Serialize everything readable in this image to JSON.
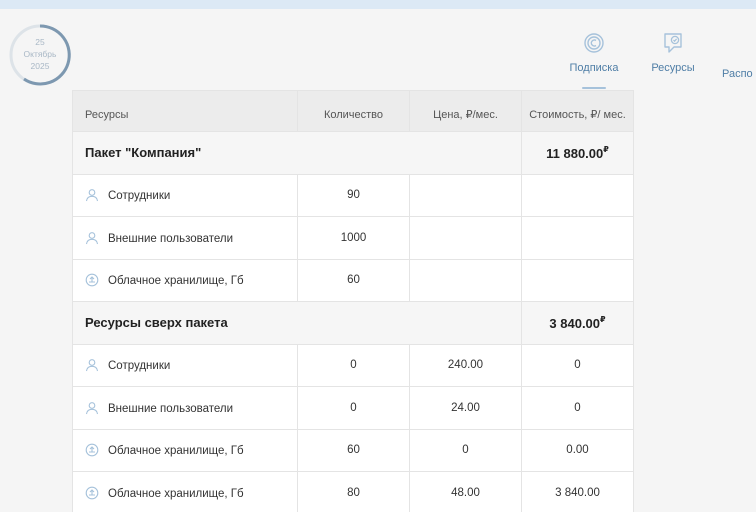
{
  "date": {
    "day": "25",
    "month": "Октябрь",
    "year": "2025"
  },
  "nav": [
    {
      "label": "Подписка",
      "icon": "subscription-icon",
      "active": true
    },
    {
      "label": "Ресурсы",
      "icon": "resources-icon",
      "active": false
    },
    {
      "label": "Распо",
      "icon": "schedule-icon",
      "active": false
    }
  ],
  "table": {
    "headers": [
      "Ресурсы",
      "Количество",
      "Цена, ₽/мес.",
      "Стоимость, ₽/ мес."
    ],
    "currency": "₽",
    "groups": [
      {
        "name": "Пакет \"Компания\"",
        "cost": "11 880.00",
        "rows": [
          {
            "icon": "user-icon",
            "name": "Сотрудники",
            "qty": "90",
            "price": "",
            "cost": ""
          },
          {
            "icon": "user-icon",
            "name": "Внешние пользователи",
            "qty": "1000",
            "price": "",
            "cost": ""
          },
          {
            "icon": "cloud-upload-icon",
            "name": "Облачное хранилище, Гб",
            "qty": "60",
            "price": "",
            "cost": ""
          }
        ]
      },
      {
        "name": "Ресурсы сверх пакета",
        "cost": "3 840.00",
        "rows": [
          {
            "icon": "user-icon",
            "name": "Сотрудники",
            "qty": "0",
            "price": "240.00",
            "cost": "0"
          },
          {
            "icon": "user-icon",
            "name": "Внешние пользователи",
            "qty": "0",
            "price": "24.00",
            "cost": "0"
          },
          {
            "icon": "cloud-upload-icon",
            "name": "Облачное хранилище, Гб",
            "qty": "60",
            "price": "0",
            "cost": "0.00"
          },
          {
            "icon": "cloud-upload-icon",
            "name": "Облачное хранилище, Гб",
            "qty": "80",
            "price": "48.00",
            "cost": "3 840.00"
          }
        ]
      }
    ]
  },
  "colors": {
    "accent": "#4f7ea6",
    "ring": "#7d98b0",
    "icon": "#a6c2db"
  }
}
